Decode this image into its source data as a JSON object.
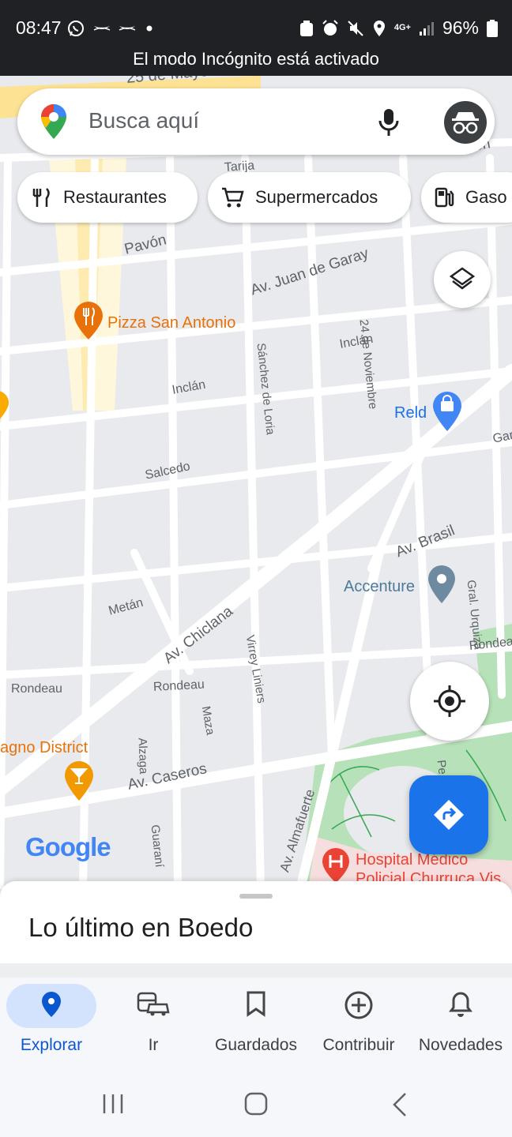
{
  "status_bar": {
    "time": "08:47",
    "network": "4G+",
    "battery": "96%",
    "banner": "El modo Incógnito está activado"
  },
  "search": {
    "placeholder": "Busca aquí"
  },
  "chips": [
    {
      "label": "Restaurantes",
      "icon": "fork-knife-icon"
    },
    {
      "label": "Supermercados",
      "icon": "cart-icon"
    },
    {
      "label": "Gaso",
      "icon": "gas-station-icon"
    }
  ],
  "map": {
    "streets": {
      "mayo": "25 de Mayo",
      "tarija": "Tarija",
      "pavon_top": "Pavón",
      "pavon": "Pavón",
      "juan_de_garay": "Av. Juan de Garay",
      "sanchez_de_loria": "Sánchez de Loria",
      "noviembre": "24 de Noviembre",
      "inclan_right": "Inclán",
      "inclan_left": "Inclán",
      "salcedo": "Salcedo",
      "gar": "Gar",
      "brasil": "Av. Brasil",
      "urquiza": "Gral. Urquiza",
      "metan": "Metán",
      "chiclana": "Av. Chiclana",
      "virrey_liniers": "Virrey Liniers",
      "rondeau_left": "Rondeau",
      "rondeau_mid": "Rondeau",
      "rondeau_right": "Rondea",
      "maza": "Maza",
      "alzaga": "Alzaga",
      "caseros": "Av. Caseros",
      "guarani": "Guaraní",
      "almafuerte": "Av. Almafuerte",
      "pe": "Pe"
    },
    "places": {
      "pizza": "Pizza San Antonio",
      "reld": "Reld",
      "accenture": "Accenture",
      "district": "agno District",
      "hospital_line1": "Hospital Médico",
      "hospital_line2": "Policial Churruca Vis"
    },
    "logo": "Google"
  },
  "sheet": {
    "title": "Lo último en Boedo"
  },
  "nav": [
    {
      "label": "Explorar",
      "icon": "location-pin-icon",
      "active": true
    },
    {
      "label": "Ir",
      "icon": "car-bus-icon",
      "active": false
    },
    {
      "label": "Guardados",
      "icon": "bookmark-icon",
      "active": false
    },
    {
      "label": "Contribuir",
      "icon": "plus-circle-icon",
      "active": false
    },
    {
      "label": "Novedades",
      "icon": "bell-icon",
      "active": false
    }
  ],
  "colors": {
    "accent": "#1a73e8",
    "restaurant": "#e8710a",
    "place": "#4d7a9a",
    "hospital": "#ea4335",
    "park": "#b7e1b8"
  }
}
